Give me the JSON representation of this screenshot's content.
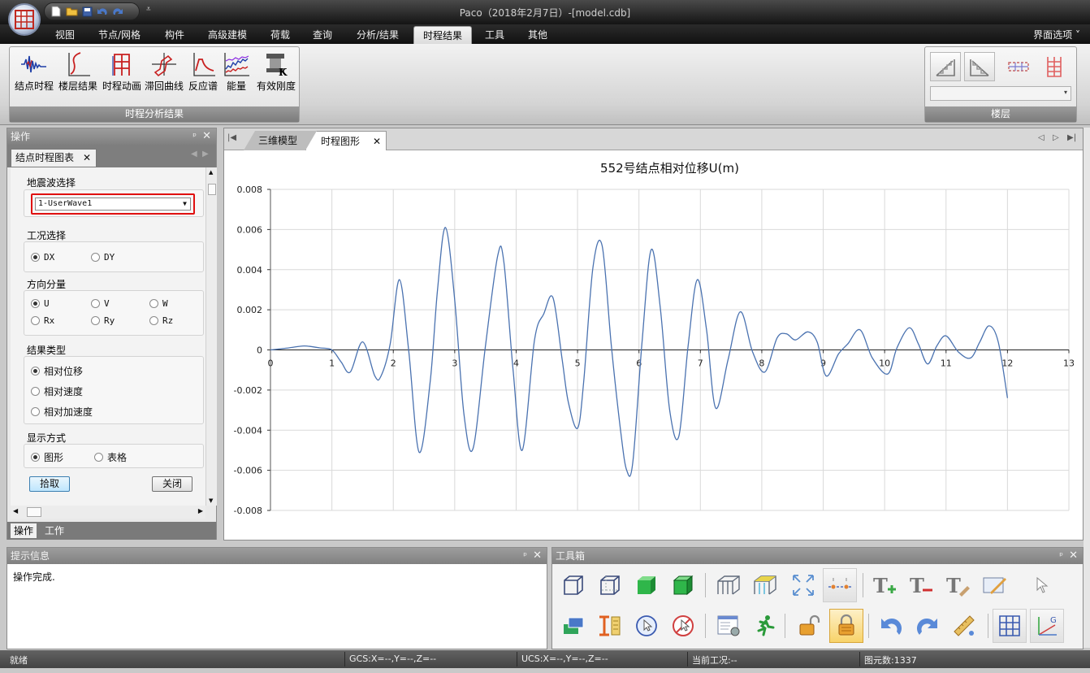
{
  "window": {
    "title": "Paco（2018年2月7日）-[model.cdb]",
    "ui_options_label": "界面选项",
    "ui_options_arrow": "˅"
  },
  "ribbon_tabs": [
    {
      "label": "视图",
      "active": false
    },
    {
      "label": "节点/网格",
      "active": false
    },
    {
      "label": "构件",
      "active": false
    },
    {
      "label": "高级建模",
      "active": false
    },
    {
      "label": "荷载",
      "active": false
    },
    {
      "label": "查询",
      "active": false
    },
    {
      "label": "分析/结果",
      "active": false
    },
    {
      "label": "时程结果",
      "active": true
    },
    {
      "label": "工具",
      "active": false
    },
    {
      "label": "其他",
      "active": false
    }
  ],
  "ribbon_group": {
    "title": "时程分析结果",
    "buttons": [
      {
        "label": "结点时程",
        "icon": "wave-signal-icon"
      },
      {
        "label": "楼层结果",
        "icon": "floor-curve-icon"
      },
      {
        "label": "时程动画",
        "icon": "frame-animation-icon"
      },
      {
        "label": "滞回曲线",
        "icon": "hysteresis-icon"
      },
      {
        "label": "反应谱",
        "icon": "response-spectrum-icon"
      },
      {
        "label": "能量",
        "icon": "energy-icon"
      },
      {
        "label": "有效刚度",
        "icon": "effective-stiffness-icon"
      }
    ]
  },
  "floor_group": {
    "title": "楼层",
    "dropdown_arrow": "▾"
  },
  "left_panel": {
    "title": "操作",
    "tab_label": "结点时程图表",
    "wave_section": {
      "title": "地震波选择",
      "selected": "1-UserWave1",
      "arrow": "▼"
    },
    "case_section": {
      "title": "工况选择",
      "options": [
        {
          "label": "DX",
          "checked": true
        },
        {
          "label": "DY",
          "checked": false
        }
      ]
    },
    "direction_section": {
      "title": "方向分量",
      "options": [
        {
          "label": "U",
          "checked": true
        },
        {
          "label": "V",
          "checked": false
        },
        {
          "label": "W",
          "checked": false
        },
        {
          "label": "Rx",
          "checked": false
        },
        {
          "label": "Ry",
          "checked": false
        },
        {
          "label": "Rz",
          "checked": false
        }
      ]
    },
    "result_section": {
      "title": "结果类型",
      "options": [
        {
          "label": "相对位移",
          "checked": true
        },
        {
          "label": "相对速度",
          "checked": false
        },
        {
          "label": "相对加速度",
          "checked": false
        }
      ]
    },
    "display_section": {
      "title": "显示方式",
      "options": [
        {
          "label": "图形",
          "checked": true
        },
        {
          "label": "表格",
          "checked": false
        }
      ]
    },
    "pick_button": "拾取",
    "close_button": "关闭",
    "bottom_tabs": [
      {
        "label": "操作",
        "active": true
      },
      {
        "label": "工作",
        "active": false
      }
    ]
  },
  "doc_tabs": [
    {
      "label": "三维模型",
      "active": false
    },
    {
      "label": "时程图形",
      "active": true
    }
  ],
  "chart_data": {
    "type": "line",
    "title": "552号结点相对位移U(m)",
    "xlabel": "",
    "ylabel": "",
    "xlim": [
      0,
      13
    ],
    "ylim": [
      -0.008,
      0.008
    ],
    "x_ticks": [
      0,
      1,
      2,
      3,
      4,
      5,
      6,
      7,
      8,
      9,
      10,
      11,
      12,
      13
    ],
    "y_ticks": [
      0.008,
      0.006,
      0.004,
      0.002,
      0,
      -0.002,
      -0.004,
      -0.006,
      -0.008
    ],
    "y_tick_labels": [
      "0.008",
      "0.006",
      "0.004",
      "0.002",
      "0",
      "-0.002",
      "-0.004",
      "-0.006",
      "-0.008"
    ],
    "grid": true,
    "color": "#4a72b0",
    "series": [
      {
        "x": [
          0,
          0.3,
          0.55,
          0.8,
          1.0,
          1.15,
          1.3,
          1.5,
          1.7,
          1.8,
          1.95,
          2.1,
          2.25,
          2.42,
          2.6,
          2.72,
          2.85,
          3.0,
          3.15,
          3.3,
          3.5,
          3.7,
          3.8,
          3.95,
          4.1,
          4.3,
          4.45,
          4.6,
          4.75,
          4.85,
          5.0,
          5.1,
          5.25,
          5.4,
          5.55,
          5.7,
          5.8,
          5.9,
          6.05,
          6.2,
          6.35,
          6.5,
          6.65,
          6.8,
          6.95,
          7.1,
          7.25,
          7.45,
          7.65,
          7.85,
          8.05,
          8.25,
          8.4,
          8.55,
          8.75,
          8.9,
          9.05,
          9.25,
          9.4,
          9.6,
          9.8,
          10.05,
          10.2,
          10.4,
          10.55,
          10.7,
          10.85,
          11.0,
          11.2,
          11.4,
          11.55,
          11.7,
          11.85,
          12.0
        ],
        "y": [
          0,
          0.0001,
          0.0002,
          0.0001,
          0,
          -0.0006,
          -0.0011,
          0.0004,
          -0.0013,
          -0.0013,
          0.0003,
          0.0035,
          0.0,
          -0.0051,
          -0.0016,
          0.003,
          0.0061,
          0.0025,
          -0.0032,
          -0.0049,
          0.0002,
          0.0047,
          0.0044,
          -0.001,
          -0.005,
          0.0005,
          0.0018,
          0.0026,
          -0.0005,
          -0.0026,
          -0.0039,
          -0.0016,
          0.0041,
          0.0052,
          0.0002,
          -0.004,
          -0.006,
          -0.0056,
          0.0004,
          0.005,
          0.002,
          -0.003,
          -0.0043,
          0.0002,
          0.0035,
          0.001,
          -0.0029,
          -0.0005,
          0.0019,
          -0.0001,
          -0.0011,
          0.0006,
          0.0008,
          0.0005,
          0.0009,
          0.0004,
          -0.0013,
          -0.0002,
          0.0003,
          0.001,
          -0.0004,
          -0.0012,
          0.0001,
          0.0011,
          0.0003,
          -0.0007,
          0.0002,
          0.0007,
          -0.0001,
          -0.0004,
          0.0004,
          0.0012,
          0.0004,
          -0.0024
        ]
      }
    ]
  },
  "info_panel": {
    "title": "提示信息",
    "message": "操作完成."
  },
  "toolbox": {
    "title": "工具箱"
  },
  "status": {
    "ready": "就绪",
    "gcs": "GCS:X=--,Y=--,Z=--",
    "ucs": "UCS:X=--,Y=--,Z=--",
    "current_case": "当前工况:--",
    "element_count": "图元数:1337"
  },
  "icons": {
    "pin": "ᵖ",
    "close": "✕"
  }
}
